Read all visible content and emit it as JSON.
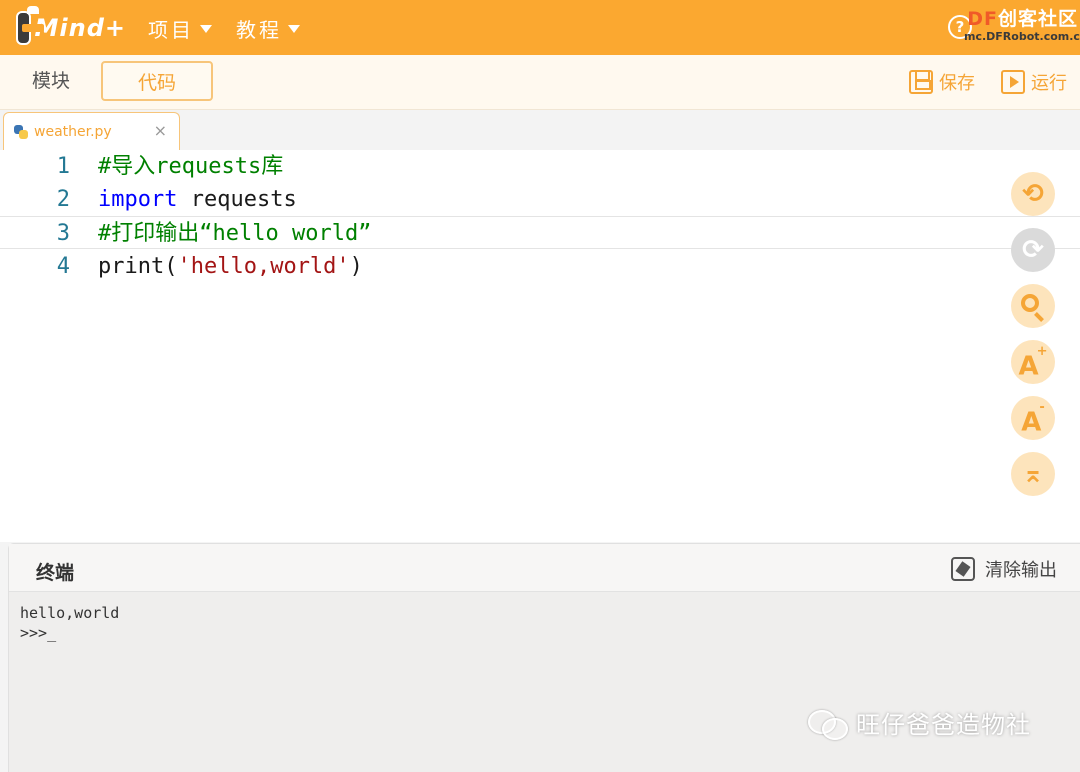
{
  "header": {
    "logo_text": "Mind+",
    "menus": [
      {
        "label": "项目"
      },
      {
        "label": "教程"
      }
    ],
    "help_icon_text": "?",
    "watermark": {
      "brand_prefix": "DF",
      "brand_suffix": "创客社区",
      "url": "mc.DFRobot.com.cn"
    }
  },
  "toolbar": {
    "tab_blocks": "模块",
    "tab_code": "代码",
    "save_label": "保存",
    "run_label": "运行"
  },
  "file_tab": {
    "name": "weather.py",
    "close": "×"
  },
  "editor": {
    "line_numbers": [
      "1",
      "2",
      "3",
      "4"
    ],
    "line1_comment": "#导入requests库",
    "line2_keyword": "import",
    "line2_rest": " requests",
    "line3_comment": "#打印输出“hello world”",
    "line4_func": "print(",
    "line4_string": "'hello,world'",
    "line4_close": ")"
  },
  "side_tools": {
    "zoom_in": "A",
    "zoom_in_sup": "+",
    "zoom_out": "A",
    "zoom_out_sup": "-"
  },
  "terminal": {
    "title": "终端",
    "clear_label": "清除输出",
    "output": [
      "hello,world",
      ">>>_"
    ]
  },
  "watermark_bottom": "旺仔爸爸造物社",
  "colors": {
    "accent": "#fba830",
    "accent_text": "#f5a536",
    "comment": "#008000",
    "keyword": "#0000ff",
    "string": "#a31515",
    "line_number": "#237893"
  }
}
